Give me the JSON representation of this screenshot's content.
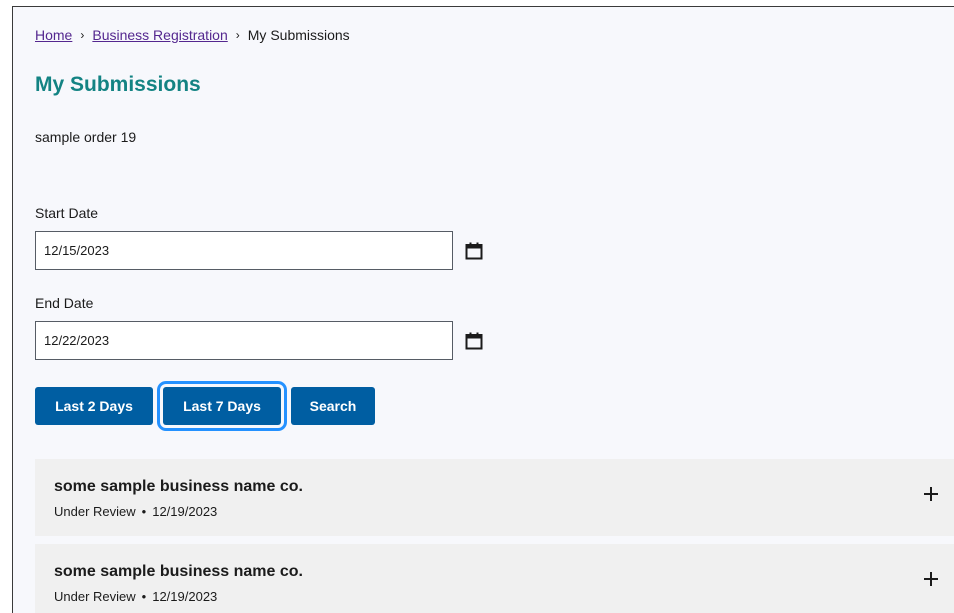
{
  "breadcrumb": {
    "home": "Home",
    "business_registration": "Business Registration",
    "current": "My Submissions",
    "separator": "›"
  },
  "page_title": "My Submissions",
  "subtitle": "sample order 19",
  "start_date": {
    "label": "Start Date",
    "value": "12/15/2023",
    "icon": "calendar-icon"
  },
  "end_date": {
    "label": "End Date",
    "value": "12/22/2023",
    "icon": "calendar-icon"
  },
  "buttons": {
    "last_2_days": "Last 2 Days",
    "last_7_days": "Last 7 Days",
    "search": "Search"
  },
  "submissions": [
    {
      "name": "some sample business name co.",
      "status": "Under Review",
      "separator": "•",
      "date": "12/19/2023",
      "expand_icon": "plus-icon"
    },
    {
      "name": "some sample business name co.",
      "status": "Under Review",
      "separator": "•",
      "date": "12/19/2023",
      "expand_icon": "plus-icon"
    }
  ],
  "colors": {
    "title": "#138383",
    "link": "#54278f",
    "button": "#005ea2",
    "focus_ring": "#2491ff",
    "accordion_bg": "#f0f0f0",
    "page_bg": "#f7f8fc"
  }
}
